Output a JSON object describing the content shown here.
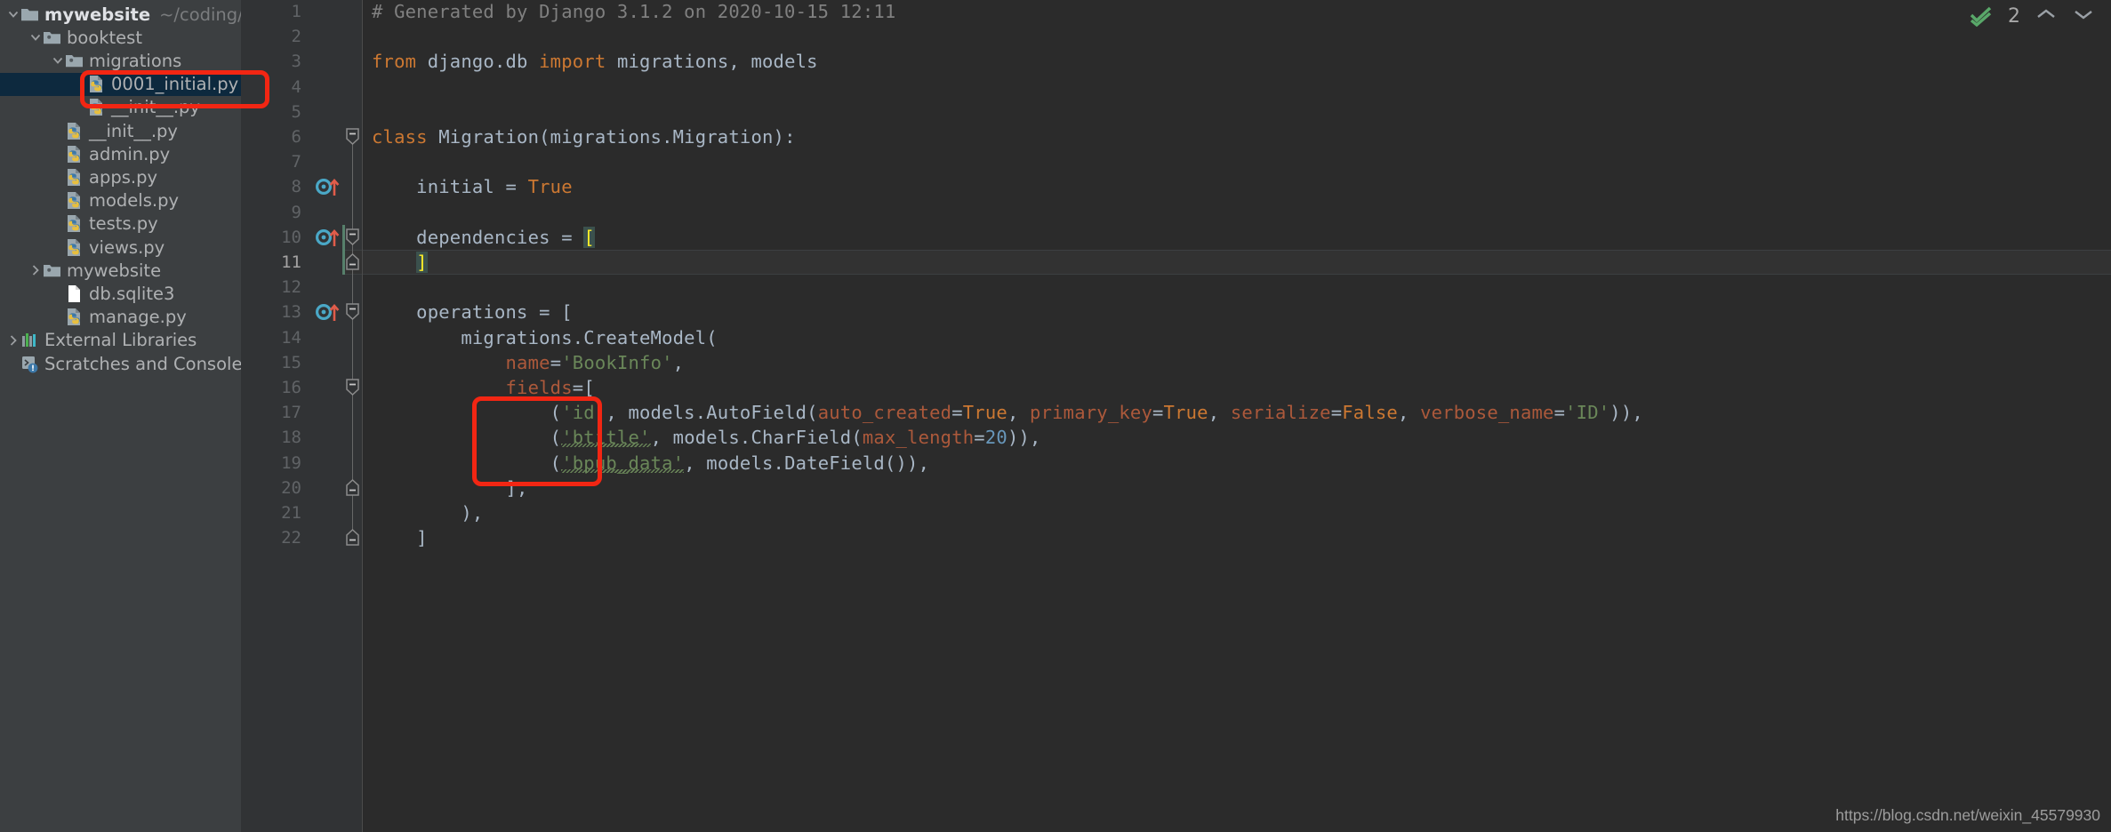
{
  "sidebar": {
    "items": [
      {
        "label": "mywebsite",
        "path_hint": "~/coding/pyth",
        "icon": "folder-open-icon",
        "indent": 0,
        "twisty": "down",
        "root": true,
        "selected": false
      },
      {
        "label": "booktest",
        "path_hint": "",
        "icon": "module-folder-icon",
        "indent": 1,
        "twisty": "down",
        "root": false,
        "selected": false
      },
      {
        "label": "migrations",
        "path_hint": "",
        "icon": "module-folder-icon",
        "indent": 2,
        "twisty": "down",
        "root": false,
        "selected": false
      },
      {
        "label": "0001_initial.py",
        "path_hint": "",
        "icon": "python-file-icon",
        "indent": 3,
        "twisty": "none",
        "root": false,
        "selected": true
      },
      {
        "label": "__init__.py",
        "path_hint": "",
        "icon": "python-file-icon",
        "indent": 3,
        "twisty": "none",
        "root": false,
        "selected": false
      },
      {
        "label": "__init__.py",
        "path_hint": "",
        "icon": "python-file-icon",
        "indent": 2,
        "twisty": "none",
        "root": false,
        "selected": false
      },
      {
        "label": "admin.py",
        "path_hint": "",
        "icon": "python-file-icon",
        "indent": 2,
        "twisty": "none",
        "root": false,
        "selected": false
      },
      {
        "label": "apps.py",
        "path_hint": "",
        "icon": "python-file-icon",
        "indent": 2,
        "twisty": "none",
        "root": false,
        "selected": false
      },
      {
        "label": "models.py",
        "path_hint": "",
        "icon": "python-file-icon",
        "indent": 2,
        "twisty": "none",
        "root": false,
        "selected": false
      },
      {
        "label": "tests.py",
        "path_hint": "",
        "icon": "python-file-icon",
        "indent": 2,
        "twisty": "none",
        "root": false,
        "selected": false
      },
      {
        "label": "views.py",
        "path_hint": "",
        "icon": "python-file-icon",
        "indent": 2,
        "twisty": "none",
        "root": false,
        "selected": false
      },
      {
        "label": "mywebsite",
        "path_hint": "",
        "icon": "module-folder-icon",
        "indent": 1,
        "twisty": "right",
        "root": false,
        "selected": false
      },
      {
        "label": "db.sqlite3",
        "path_hint": "",
        "icon": "generic-file-icon",
        "indent": 2,
        "twisty": "none",
        "root": false,
        "selected": false
      },
      {
        "label": "manage.py",
        "path_hint": "",
        "icon": "python-file-icon",
        "indent": 2,
        "twisty": "none",
        "root": false,
        "selected": false
      },
      {
        "label": "External Libraries",
        "path_hint": "",
        "icon": "libraries-icon",
        "indent": 0,
        "twisty": "right",
        "root": false,
        "selected": false
      },
      {
        "label": "Scratches and Consoles",
        "path_hint": "",
        "icon": "scratches-icon",
        "indent": 0,
        "twisty": "none",
        "root": false,
        "selected": false
      }
    ]
  },
  "inspector": {
    "count": "2",
    "up_icon": "chevron-up-icon",
    "down_icon": "chevron-down-icon",
    "status_icon": "inspection-ok-icon"
  },
  "watermark": "https://blog.csdn.net/weixin_45579930",
  "editor": {
    "current_line": 11,
    "lines": [
      {
        "n": 1,
        "tokens": [
          {
            "t": "# Generated by Django 3.1.2 on 2020-10-15 12:11",
            "c": "c-comment"
          }
        ]
      },
      {
        "n": 2,
        "tokens": []
      },
      {
        "n": 3,
        "tokens": [
          {
            "t": "from",
            "c": "c-kw"
          },
          {
            "t": " django.db ",
            "c": "c-default"
          },
          {
            "t": "import",
            "c": "c-kw"
          },
          {
            "t": " migrations, models",
            "c": "c-default"
          }
        ]
      },
      {
        "n": 4,
        "tokens": []
      },
      {
        "n": 5,
        "tokens": []
      },
      {
        "n": 6,
        "tokens": [
          {
            "t": "class",
            "c": "c-kw"
          },
          {
            "t": " Migration(migrations.Migration):",
            "c": "c-default"
          }
        ]
      },
      {
        "n": 7,
        "tokens": []
      },
      {
        "n": 8,
        "tokens": [
          {
            "t": "    initial = ",
            "c": "c-default"
          },
          {
            "t": "True",
            "c": "c-kw"
          }
        ]
      },
      {
        "n": 9,
        "tokens": []
      },
      {
        "n": 10,
        "tokens": [
          {
            "t": "    dependencies = ",
            "c": "c-default"
          },
          {
            "t": "[",
            "c": "brace-hl"
          }
        ]
      },
      {
        "n": 11,
        "tokens": [
          {
            "t": "    ",
            "c": "c-default"
          },
          {
            "t": "]",
            "c": "brace-hl"
          }
        ]
      },
      {
        "n": 12,
        "tokens": []
      },
      {
        "n": 13,
        "tokens": [
          {
            "t": "    operations = [",
            "c": "c-default"
          }
        ]
      },
      {
        "n": 14,
        "tokens": [
          {
            "t": "        migrations.CreateModel(",
            "c": "c-default"
          }
        ]
      },
      {
        "n": 15,
        "tokens": [
          {
            "t": "            ",
            "c": "c-default"
          },
          {
            "t": "name",
            "c": "c-param"
          },
          {
            "t": "=",
            "c": "c-default"
          },
          {
            "t": "'BookInfo'",
            "c": "c-str"
          },
          {
            "t": ",",
            "c": "c-default"
          }
        ]
      },
      {
        "n": 16,
        "tokens": [
          {
            "t": "            ",
            "c": "c-default"
          },
          {
            "t": "fields",
            "c": "c-param"
          },
          {
            "t": "=[",
            "c": "c-default"
          }
        ]
      },
      {
        "n": 17,
        "tokens": [
          {
            "t": "                (",
            "c": "c-default"
          },
          {
            "t": "'id'",
            "c": "c-str"
          },
          {
            "t": ", models.AutoField(",
            "c": "c-default"
          },
          {
            "t": "auto_created",
            "c": "c-param"
          },
          {
            "t": "=",
            "c": "c-default"
          },
          {
            "t": "True",
            "c": "c-kw"
          },
          {
            "t": ", ",
            "c": "c-default"
          },
          {
            "t": "primary_key",
            "c": "c-param"
          },
          {
            "t": "=",
            "c": "c-default"
          },
          {
            "t": "True",
            "c": "c-kw"
          },
          {
            "t": ", ",
            "c": "c-default"
          },
          {
            "t": "serialize",
            "c": "c-param"
          },
          {
            "t": "=",
            "c": "c-default"
          },
          {
            "t": "False",
            "c": "c-kw"
          },
          {
            "t": ", ",
            "c": "c-default"
          },
          {
            "t": "verbose_name",
            "c": "c-param"
          },
          {
            "t": "=",
            "c": "c-default"
          },
          {
            "t": "'ID'",
            "c": "c-str"
          },
          {
            "t": ")),",
            "c": "c-default"
          }
        ]
      },
      {
        "n": 18,
        "tokens": [
          {
            "t": "                (",
            "c": "c-default"
          },
          {
            "t": "'btitle'",
            "c": "c-str typo"
          },
          {
            "t": ", models.CharField(",
            "c": "c-default"
          },
          {
            "t": "max_length",
            "c": "c-param"
          },
          {
            "t": "=",
            "c": "c-default"
          },
          {
            "t": "20",
            "c": "c-num"
          },
          {
            "t": ")),",
            "c": "c-default"
          }
        ]
      },
      {
        "n": 19,
        "tokens": [
          {
            "t": "                (",
            "c": "c-default"
          },
          {
            "t": "'bpub_data'",
            "c": "c-str typo"
          },
          {
            "t": ", models.DateField()),",
            "c": "c-default"
          }
        ]
      },
      {
        "n": 20,
        "tokens": [
          {
            "t": "            ],",
            "c": "c-default"
          }
        ]
      },
      {
        "n": 21,
        "tokens": [
          {
            "t": "        ),",
            "c": "c-default"
          }
        ]
      },
      {
        "n": 22,
        "tokens": [
          {
            "t": "    ]",
            "c": "c-default"
          }
        ]
      }
    ],
    "gutter_markers": [
      {
        "line": 8,
        "type": "override-marker-icon"
      },
      {
        "line": 10,
        "type": "override-marker-icon"
      },
      {
        "line": 13,
        "type": "override-marker-icon"
      }
    ],
    "fold_markers": [
      {
        "line": 6,
        "type": "fold-collapse-icon"
      },
      {
        "line": 10,
        "type": "fold-collapse-icon"
      },
      {
        "line": 11,
        "type": "fold-end-icon"
      },
      {
        "line": 13,
        "type": "fold-collapse-icon"
      },
      {
        "line": 16,
        "type": "fold-collapse-icon"
      },
      {
        "line": 20,
        "type": "fold-end-icon"
      },
      {
        "line": 22,
        "type": "fold-end-icon"
      }
    ]
  },
  "annotations": {
    "filename_box": "0001_initial.py",
    "fields_box": "field name column"
  },
  "colors": {
    "accent_red": "#f22613",
    "sidebar_bg": "#3c3f41",
    "editor_bg": "#2b2b2b",
    "gutter_bg": "#313335",
    "selection_bg": "#0d293e",
    "string_green": "#6a8759",
    "keyword_orange": "#cc7832",
    "number_blue": "#6897bb",
    "param_brown": "#ac593b",
    "ok_green": "#59a869"
  }
}
